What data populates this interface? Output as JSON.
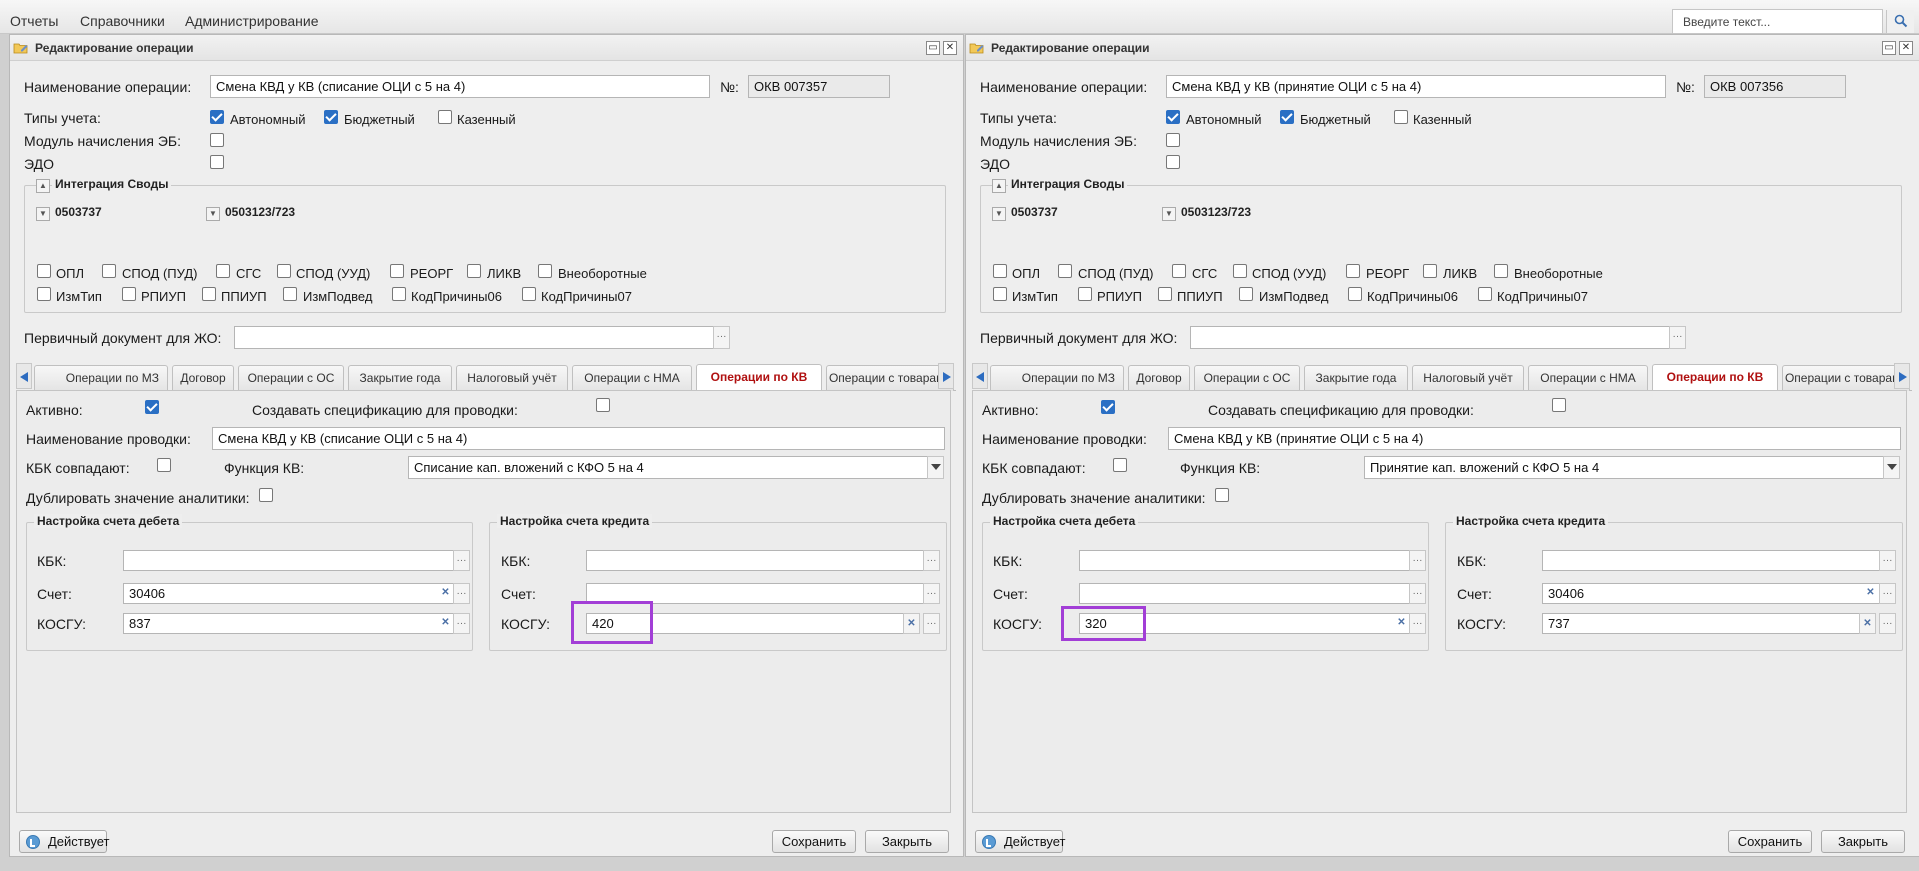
{
  "menu": {
    "items": [
      "Отчеты",
      "Справочники",
      "Администрирование"
    ]
  },
  "search": {
    "placeholder": "Введите текст..."
  },
  "windows": [
    {
      "title": "Редактирование операции",
      "op_name_label": "Наименование операции:",
      "op_name": "Смена КВД у КВ (списание ОЦИ с 5 на 4)",
      "num_label": "№:",
      "num": "ОКВ 007357",
      "acc_types_label": "Типы учета:",
      "acc_types": [
        {
          "label": "Автономный",
          "checked": true
        },
        {
          "label": "Бюджетный",
          "checked": true
        },
        {
          "label": "Казенный",
          "checked": false
        }
      ],
      "eb_label": "Модуль начисления ЭБ:",
      "edo_label": "ЭДО",
      "integration": {
        "legend": "Интеграция Своды",
        "groups": [
          "0503737",
          "0503123/723"
        ],
        "row1": [
          "ОПЛ",
          "СПОД (ПУД)",
          "СГС",
          "СПОД (УУД)",
          "РЕОРГ",
          "ЛИКВ",
          "Внеоборотные"
        ],
        "row2": [
          "ИзмТип",
          "РПИУП",
          "ППИУП",
          "ИзмПодвед",
          "КодПричины06",
          "КодПричины07"
        ]
      },
      "primary_doc_label": "Первичный документ для ЖО:",
      "tabs": [
        "Операции по МЗ",
        "Договор",
        "Операции с ОС",
        "Закрытие года",
        "Налоговый учёт",
        "Операции с НМА",
        "Операции по КВ",
        "Операции с товарами"
      ],
      "active_tab": "Операции по КВ",
      "active_label": "Активно:",
      "active_checked": true,
      "spec_label": "Создавать спецификацию для проводки:",
      "posting_name_label": "Наименование проводки:",
      "posting_name": "Смена КВД у КВ (списание ОЦИ с 5 на 4)",
      "kbk_match_label": "КБК совпадают:",
      "kv_function_label": "Функция КВ:",
      "kv_function": "Списание кап. вложений с КФО 5 на 4",
      "duplicate_label": "Дублировать значение аналитики:",
      "debit": {
        "legend": "Настройка счета дебета",
        "kbk_label": "КБК:",
        "kbk": "",
        "account_label": "Счет:",
        "account": "30406",
        "kosgu_label": "КОСГУ:",
        "kosgu": "837"
      },
      "credit": {
        "legend": "Настройка счета кредита",
        "kbk_label": "КБК:",
        "kbk": "",
        "account_label": "Счет:",
        "account": "",
        "kosgu_label": "КОСГУ:",
        "kosgu": "420"
      },
      "status_label": "Действует",
      "save_label": "Сохранить",
      "close_label": "Закрыть"
    },
    {
      "title": "Редактирование операции",
      "op_name_label": "Наименование операции:",
      "op_name": "Смена КВД у КВ (принятие ОЦИ с 5 на 4)",
      "num_label": "№:",
      "num": "ОКВ 007356",
      "acc_types_label": "Типы учета:",
      "acc_types": [
        {
          "label": "Автономный",
          "checked": true
        },
        {
          "label": "Бюджетный",
          "checked": true
        },
        {
          "label": "Казенный",
          "checked": false
        }
      ],
      "eb_label": "Модуль начисления ЭБ:",
      "edo_label": "ЭДО",
      "integration": {
        "legend": "Интеграция Своды",
        "groups": [
          "0503737",
          "0503123/723"
        ],
        "row1": [
          "ОПЛ",
          "СПОД (ПУД)",
          "СГС",
          "СПОД (УУД)",
          "РЕОРГ",
          "ЛИКВ",
          "Внеоборотные"
        ],
        "row2": [
          "ИзмТип",
          "РПИУП",
          "ППИУП",
          "ИзмПодвед",
          "КодПричины06",
          "КодПричины07"
        ]
      },
      "primary_doc_label": "Первичный документ для ЖО:",
      "tabs": [
        "Операции по МЗ",
        "Договор",
        "Операции с ОС",
        "Закрытие года",
        "Налоговый учёт",
        "Операции с НМА",
        "Операции по КВ",
        "Операции с товарами"
      ],
      "active_tab": "Операции по КВ",
      "active_label": "Активно:",
      "active_checked": true,
      "spec_label": "Создавать спецификацию для проводки:",
      "posting_name_label": "Наименование проводки:",
      "posting_name": "Смена КВД у КВ (принятие ОЦИ с 5 на 4)",
      "kbk_match_label": "КБК совпадают:",
      "kv_function_label": "Функция КВ:",
      "kv_function": "Принятие кап. вложений с КФО 5 на 4",
      "duplicate_label": "Дублировать значение аналитики:",
      "debit": {
        "legend": "Настройка счета дебета",
        "kbk_label": "КБК:",
        "kbk": "",
        "account_label": "Счет:",
        "account": "",
        "kosgu_label": "КОСГУ:",
        "kosgu": "320"
      },
      "credit": {
        "legend": "Настройка счета кредита",
        "kbk_label": "КБК:",
        "kbk": "",
        "account_label": "Счет:",
        "account": "30406",
        "kosgu_label": "КОСГУ:",
        "kosgu": "737"
      },
      "status_label": "Действует",
      "save_label": "Сохранить",
      "close_label": "Закрыть"
    }
  ]
}
